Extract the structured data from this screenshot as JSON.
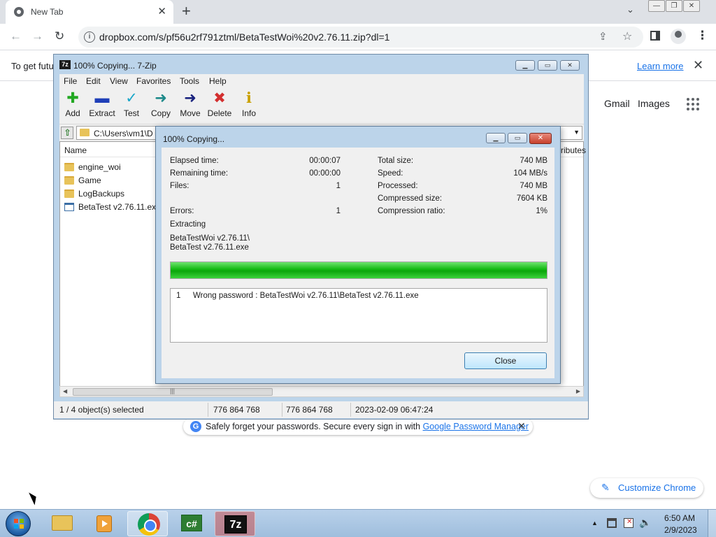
{
  "browser": {
    "tab_title": "New Tab",
    "new_tab_glyph": "+",
    "url": "dropbox.com/s/pf56u2rf791ztml/BetaTestWoi%20v2.76.11.zip?dl=1",
    "infobar_text": "To get futu",
    "learn_more": "Learn more",
    "gmail": "Gmail",
    "images": "Images",
    "password_banner_text": "Safely forget your passwords. Secure every sign in with ",
    "password_banner_link": "Google Password Manager",
    "customize_chrome": "Customize Chrome",
    "icons": [
      "back-arrow-icon",
      "forward-arrow-icon",
      "reload-icon",
      "share-icon",
      "star-icon",
      "profile-icon",
      "menu-dots-icon",
      "apps-grid-icon",
      "pencil-icon"
    ]
  },
  "filemanager": {
    "title": "100% Copying... 7-Zip",
    "app_icon": "7z",
    "menu": [
      "File",
      "Edit",
      "View",
      "Favorites",
      "Tools",
      "Help"
    ],
    "toolbar": [
      {
        "label": "Add",
        "glyph": "✚",
        "color": "#22a822"
      },
      {
        "label": "Extract",
        "glyph": "▬",
        "color": "#1f3fb8"
      },
      {
        "label": "Test",
        "glyph": "✓",
        "color": "#18a6c8"
      },
      {
        "label": "Copy",
        "glyph": "➜",
        "color": "#1e8a8a"
      },
      {
        "label": "Move",
        "glyph": "➜",
        "color": "#1a237e"
      },
      {
        "label": "Delete",
        "glyph": "✖",
        "color": "#d32f2f"
      },
      {
        "label": "Info",
        "glyph": "ℹ",
        "color": "#c9a000"
      }
    ],
    "path": "C:\\Users\\vm1\\D",
    "columns": {
      "name": "Name",
      "attributes": "ributes"
    },
    "files": [
      {
        "name": "engine_woi",
        "type": "folder"
      },
      {
        "name": "Game",
        "type": "folder"
      },
      {
        "name": "LogBackups",
        "type": "folder"
      },
      {
        "name": "BetaTest v2.76.11.exe",
        "type": "exe"
      }
    ],
    "status": {
      "selected": "1 / 4 object(s) selected",
      "size": "776 864 768",
      "packed": "776 864 768",
      "modified": "2023-02-09 06:47:24"
    }
  },
  "dialog": {
    "title": "100% Copying...",
    "left": [
      {
        "label": "Elapsed time:",
        "value": "00:00:07"
      },
      {
        "label": "Remaining time:",
        "value": "00:00:00"
      },
      {
        "label": "Files:",
        "value": "1"
      },
      {
        "label": "",
        "value": ""
      },
      {
        "label": "Errors:",
        "value": "1"
      }
    ],
    "right": [
      {
        "label": "Total size:",
        "value": "740 MB"
      },
      {
        "label": "Speed:",
        "value": "104 MB/s"
      },
      {
        "label": "Processed:",
        "value": "740 MB"
      },
      {
        "label": "Compressed size:",
        "value": "7604 KB"
      },
      {
        "label": "Compression ratio:",
        "value": "1%"
      }
    ],
    "operation": "Extracting",
    "current_path_line1": "BetaTestWoi v2.76.11\\",
    "current_path_line2": "BetaTest v2.76.11.exe",
    "progress": 1.0,
    "progress_color": "#12b812",
    "log": [
      {
        "num": "1",
        "message": "Wrong password : BetaTestWoi v2.76.11\\BetaTest v2.76.11.exe"
      }
    ],
    "close_button": "Close"
  },
  "taskbar": {
    "clock_time": "6:50 AM",
    "clock_date": "2/9/2023",
    "csharp_label": "c#",
    "sevenzip_label": "7z"
  }
}
